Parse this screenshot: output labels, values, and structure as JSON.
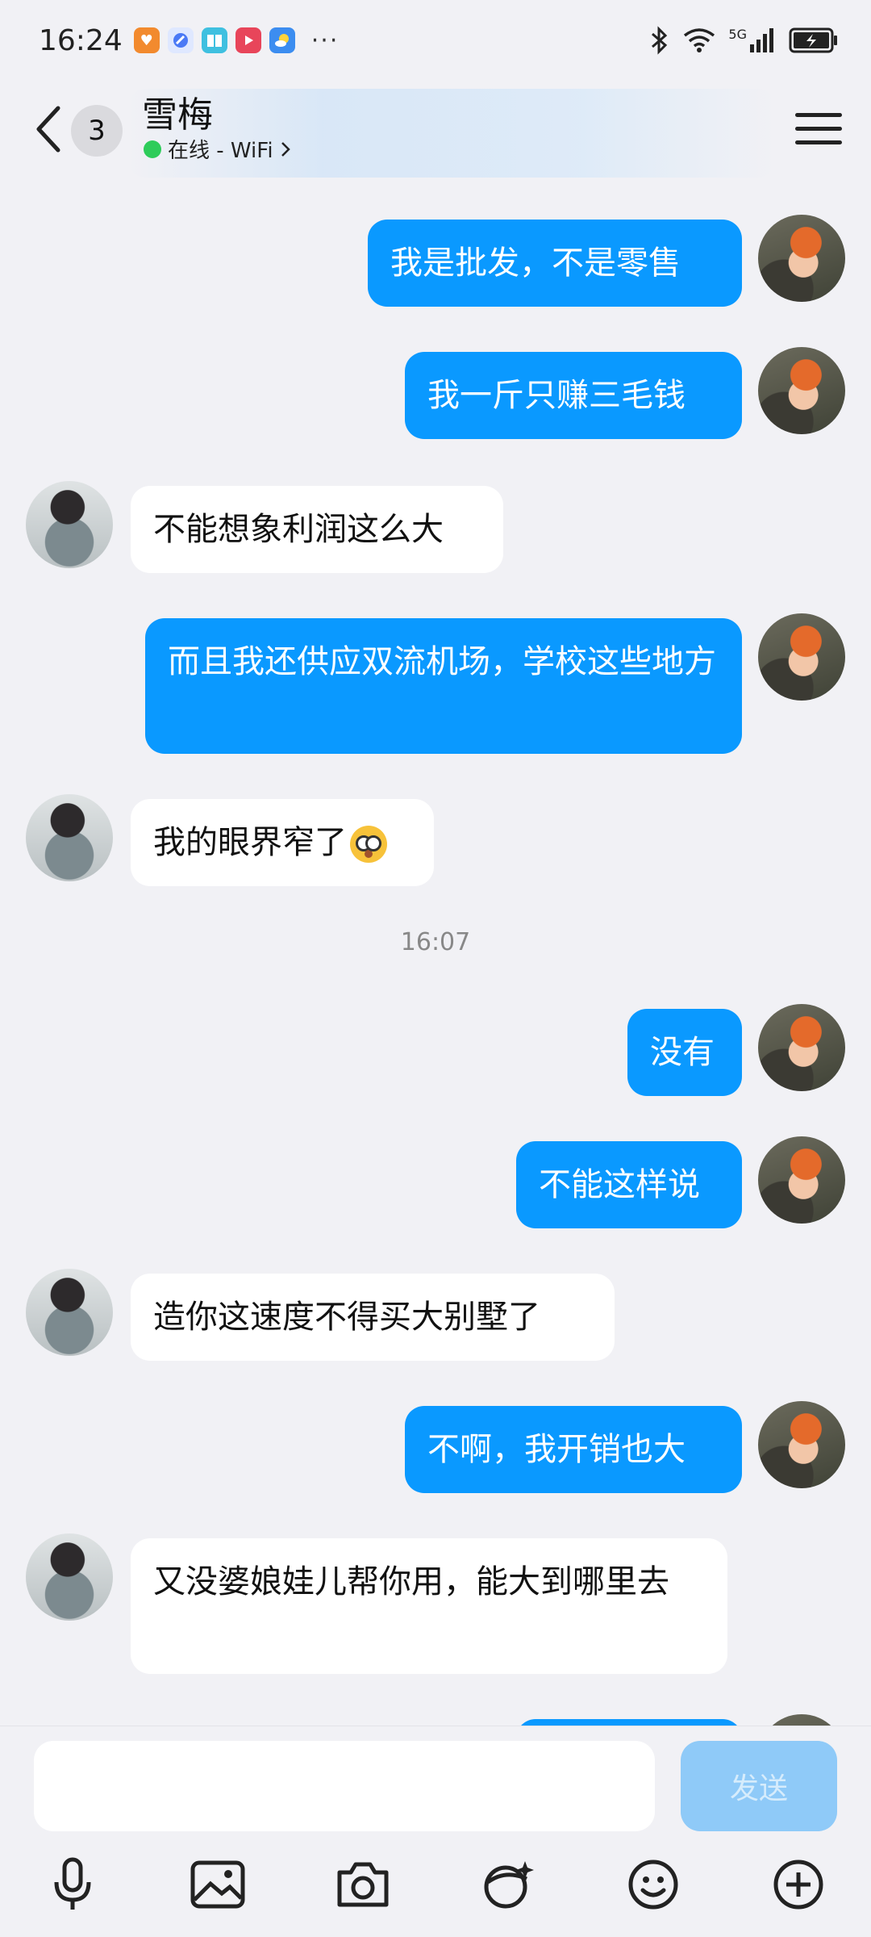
{
  "status_bar": {
    "time": "16:24",
    "more_indicator": "···",
    "network": "5G",
    "notification_icons": [
      "orange-app-icon",
      "blue-app-icon",
      "book-app-icon",
      "video-app-icon",
      "weather-app-icon"
    ]
  },
  "header": {
    "unread_count": "3",
    "contact_name": "雪梅",
    "presence": "在线 - WiFi",
    "online_color": "#2ecc5a"
  },
  "colors": {
    "outgoing_bubble": "#0a99ff",
    "incoming_bubble": "#ffffff",
    "background": "#f1f1f5"
  },
  "messages": [
    {
      "from": "me",
      "text": "我是批发，不是零售"
    },
    {
      "from": "me",
      "text": "我一斤只赚三毛钱"
    },
    {
      "from": "her",
      "text": "不能想象利润这么大"
    },
    {
      "from": "me",
      "text": "而且我还供应双流机场，学校这些地方"
    },
    {
      "from": "her",
      "text": "我的眼界窄了",
      "emoji": "flushed-face-emoji"
    },
    {
      "from": "me",
      "text": "没有"
    },
    {
      "from": "me",
      "text": "不能这样说"
    },
    {
      "from": "her",
      "text": "造你这速度不得买大别墅了"
    },
    {
      "from": "me",
      "text": "不啊，我开销也大"
    },
    {
      "from": "her",
      "text": "又没婆娘娃儿帮你用，能大到哪里去"
    }
  ],
  "timestamp": "16:07",
  "input": {
    "value": "",
    "send_label": "发送"
  },
  "toolbar": [
    "microphone-icon",
    "image-icon",
    "camera-icon",
    "sticker-icon",
    "emoji-icon",
    "plus-icon"
  ]
}
